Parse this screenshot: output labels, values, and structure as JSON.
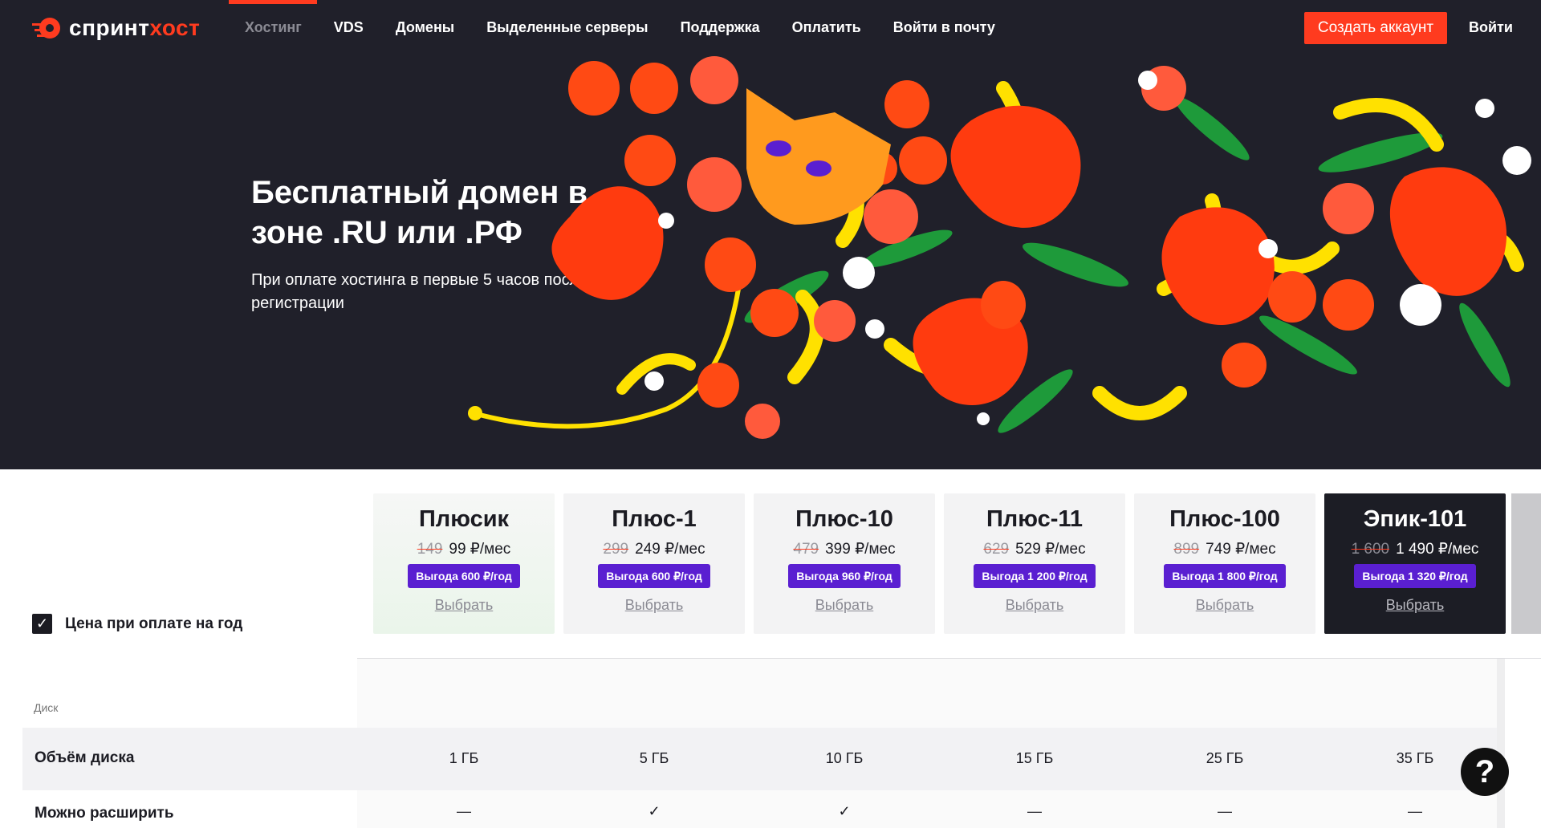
{
  "header": {
    "logo_main": "спринт",
    "logo_accent": "хост",
    "nav": [
      "Хостинг",
      "VDS",
      "Домены",
      "Выделенные серверы",
      "Поддержка",
      "Оплатить",
      "Войти в почту"
    ],
    "create_account": "Создать аккаунт",
    "login": "Войти"
  },
  "hero": {
    "title": "Бесплатный домен в зоне .RU или .РФ",
    "subtitle": "При оплате хостинга в первые 5 часов после регистрации"
  },
  "pricing": {
    "year_toggle": {
      "label": "Цена при оплате на год",
      "checked": true
    },
    "plans": [
      {
        "name": "Плюсик",
        "old_price": "149",
        "price": "99 ₽/мес",
        "benefit": "Выгода 600 ₽/год",
        "choose": "Выбрать"
      },
      {
        "name": "Плюс-1",
        "old_price": "299",
        "price": "249 ₽/мес",
        "benefit": "Выгода 600 ₽/год",
        "choose": "Выбрать"
      },
      {
        "name": "Плюс-10",
        "old_price": "479",
        "price": "399 ₽/мес",
        "benefit": "Выгода 960 ₽/год",
        "choose": "Выбрать"
      },
      {
        "name": "Плюс-11",
        "old_price": "629",
        "price": "529 ₽/мес",
        "benefit": "Выгода 1 200 ₽/год",
        "choose": "Выбрать"
      },
      {
        "name": "Плюс-100",
        "old_price": "899",
        "price": "749 ₽/мес",
        "benefit": "Выгода 1 800 ₽/год",
        "choose": "Выбрать"
      },
      {
        "name": "Эпик-101",
        "old_price": "1 600",
        "price": "1 490 ₽/мес",
        "benefit": "Выгода 1 320 ₽/год",
        "choose": "Выбрать"
      }
    ]
  },
  "features": {
    "section_label": "Диск",
    "rows": [
      {
        "label": "Объём диска",
        "values": [
          "1 ГБ",
          "5 ГБ",
          "10 ГБ",
          "15 ГБ",
          "25 ГБ",
          "35 ГБ"
        ]
      },
      {
        "label": "Можно расширить",
        "values": [
          "—",
          "✓",
          "✓",
          "—",
          "—",
          "—"
        ]
      }
    ]
  },
  "help": {
    "label": "?"
  },
  "colors": {
    "accent": "#ff3b1f",
    "hero_bg": "#20202a",
    "badge": "#5a1fd1"
  }
}
